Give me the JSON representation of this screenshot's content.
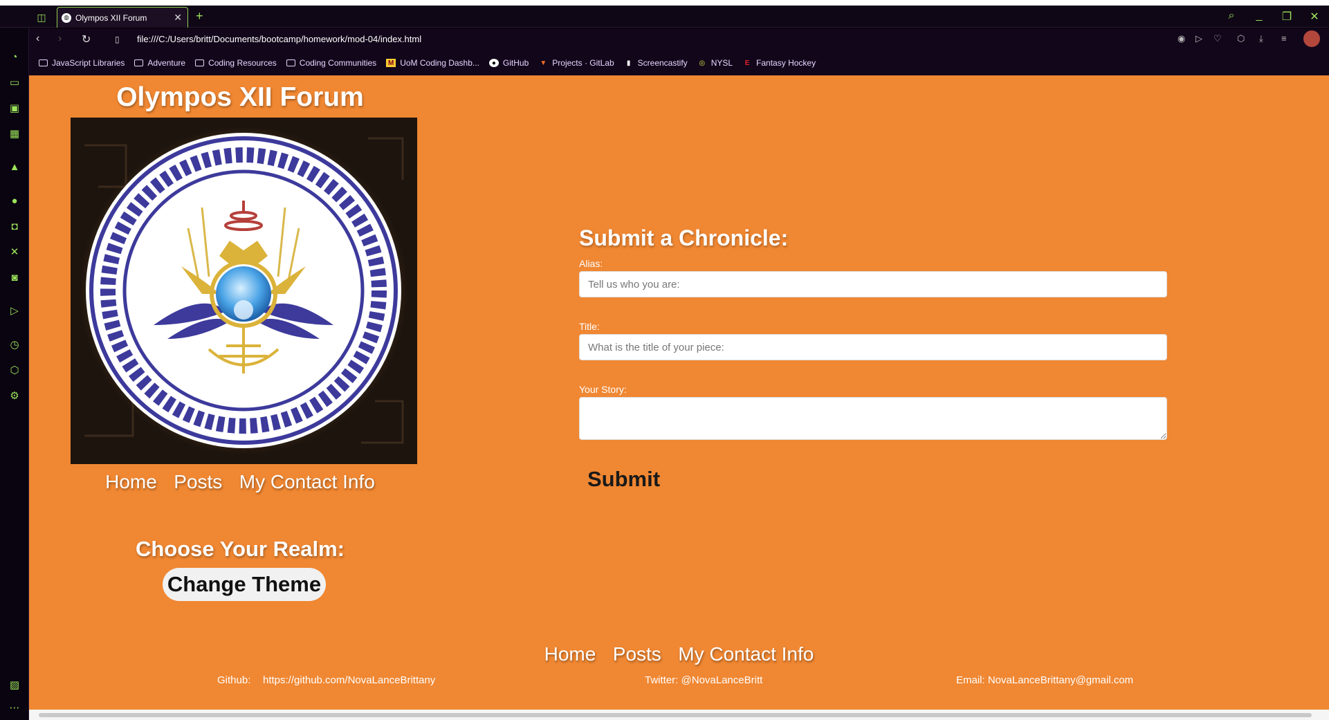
{
  "browser": {
    "tab_title": "Olympos XII Forum",
    "url": "file:///C:/Users/britt/Documents/bootcamp/homework/mod-04/index.html",
    "bookmarks": [
      {
        "label": "JavaScript Libraries",
        "icon": "folder-icon"
      },
      {
        "label": "Adventure",
        "icon": "folder-icon"
      },
      {
        "label": "Coding Resources",
        "icon": "folder-icon"
      },
      {
        "label": "Coding Communities",
        "icon": "folder-icon"
      },
      {
        "label": "UoM Coding Dashb...",
        "icon": "umn-icon"
      },
      {
        "label": "GitHub",
        "icon": "github-icon"
      },
      {
        "label": "Projects · GitLab",
        "icon": "gitlab-icon"
      },
      {
        "label": "Screencastify",
        "icon": "page-icon"
      },
      {
        "label": "NYSL",
        "icon": "nysl-icon"
      },
      {
        "label": "Fantasy Hockey",
        "icon": "espn-icon"
      }
    ],
    "accent_color": "#9be35a"
  },
  "page": {
    "background": "#f08732",
    "site_title": "Olympos XII Forum",
    "nav": {
      "home": "Home",
      "posts": "Posts",
      "contact": "My Contact Info"
    },
    "realm_heading": "Choose Your Realm:",
    "theme_button": "Change Theme",
    "form": {
      "heading": "Submit a Chronicle:",
      "alias_label": "Alias:",
      "alias_placeholder": "Tell us who you are:",
      "title_label": "Title:",
      "title_placeholder": "What is the title of your piece:",
      "story_label": "Your Story:",
      "submit": "Submit"
    },
    "footer": {
      "nav": {
        "home": "Home",
        "posts": "Posts",
        "contact": "My Contact Info"
      },
      "github_label": "Github:",
      "github_url": "https://github.com/NovaLanceBrittany",
      "twitter": "Twitter: @NovaLanceBritt",
      "email": "Email: NovaLanceBrittany@gmail.com"
    }
  }
}
